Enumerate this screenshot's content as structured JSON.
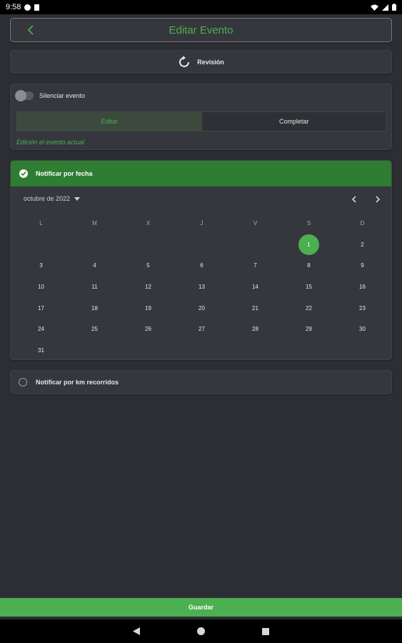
{
  "status_bar": {
    "time": "9:58"
  },
  "app_bar": {
    "title": "Editar Evento",
    "back_icon": "chevron-left-icon"
  },
  "revision": {
    "label": "Revisión",
    "icon": "refresh-icon"
  },
  "event": {
    "mute_label": "Silenciar evento",
    "mute_on": false,
    "tabs": [
      {
        "label": "Editar",
        "active": true
      },
      {
        "label": "Completar",
        "active": false
      }
    ],
    "hint": "Edición el evento actual"
  },
  "notify_date": {
    "label": "Notificar por fecha",
    "checked": true,
    "month_label": "octubre de 2022",
    "weekdays": [
      "L",
      "M",
      "X",
      "J",
      "V",
      "S",
      "D"
    ],
    "weeks": [
      [
        "",
        "",
        "",
        "",
        "",
        "1",
        "2"
      ],
      [
        "3",
        "4",
        "5",
        "6",
        "7",
        "8",
        "9"
      ],
      [
        "10",
        "11",
        "12",
        "13",
        "14",
        "15",
        "16"
      ],
      [
        "17",
        "18",
        "19",
        "20",
        "21",
        "22",
        "23"
      ],
      [
        "24",
        "25",
        "26",
        "27",
        "28",
        "29",
        "30"
      ],
      [
        "31",
        "",
        "",
        "",
        "",
        "",
        ""
      ]
    ],
    "selected_day": "1"
  },
  "notify_km": {
    "label": "Notificar por km recorridos",
    "checked": false
  },
  "save_button": {
    "label": "Guardar"
  },
  "colors": {
    "accent": "#4caf50",
    "header_green": "#2e7d32",
    "background": "#2d2e33",
    "card": "#36373d"
  }
}
